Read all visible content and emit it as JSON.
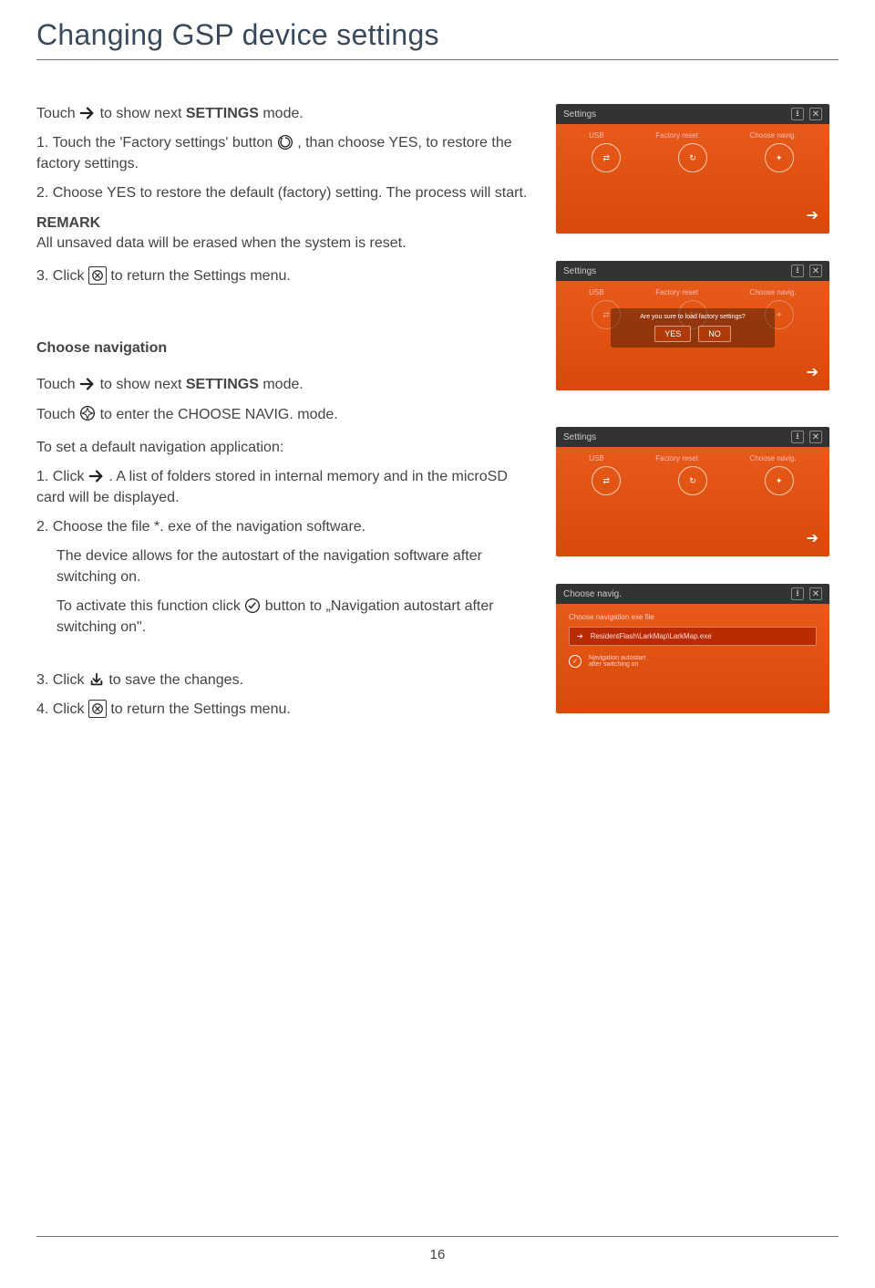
{
  "title": "Changing GSP device settings",
  "touchNext": {
    "pre": "Touch ",
    "post": " to show next ",
    "bold": "SETTINGS",
    "post2": " mode."
  },
  "step1": {
    "num": "1. ",
    "a": "Touch the 'Factory settings' button ",
    "b": " , than choose YES, to restore the factory settings."
  },
  "step2": {
    "num": "2. ",
    "a": "Choose YES to restore the default (factory) setting. The process will start."
  },
  "remarkHd": "REMARK",
  "remarkBody": "All unsaved data will be erased when the system is reset.",
  "step3": {
    "num": "3. ",
    "a": "Click ",
    "b": " to return the Settings menu."
  },
  "chooseNavHd": "Choose navigation",
  "touchNext2": {
    "pre": "Touch ",
    "post": " to show next ",
    "bold": "SETTINGS",
    "post2": " mode."
  },
  "touchNavig": {
    "pre": "Touch ",
    "post": " to enter the CHOOSE NAVIG. mode."
  },
  "setDefault": "To set a default navigation application:",
  "n1": {
    "num": "1. ",
    "a": "Click ",
    "b": " . A list of folders stored in internal memory and in the microSD card will be displayed."
  },
  "n2": {
    "num": "2. ",
    "a": "Choose the file *. exe of the navigation software."
  },
  "n2b": "The device allows for the autostart of the navigation software after switching on.",
  "n2c": {
    "a": "To activate this function click ",
    "b": " button to „Navigation autostart after switching on\"."
  },
  "n3": {
    "num": "3. ",
    "a": "Click ",
    "b": " to save the changes."
  },
  "n4": {
    "num": "4. ",
    "a": "Click ",
    "b": " to return the Settings menu."
  },
  "ss": {
    "settings": "Settings",
    "tabs": [
      "USB",
      "Factory reset",
      "Choose navig."
    ],
    "dialogQ": "Are you sure to load factory settings?",
    "yes": "YES",
    "no": "NO",
    "chooseNavig": "Choose navig.",
    "navFileLabel": "Choose navigation exe file",
    "navFile": "ResidentFlash\\LarkMap\\LarkMap.exe",
    "autostart": "Navigation autostart\nafter switching on"
  },
  "pageNum": "16"
}
